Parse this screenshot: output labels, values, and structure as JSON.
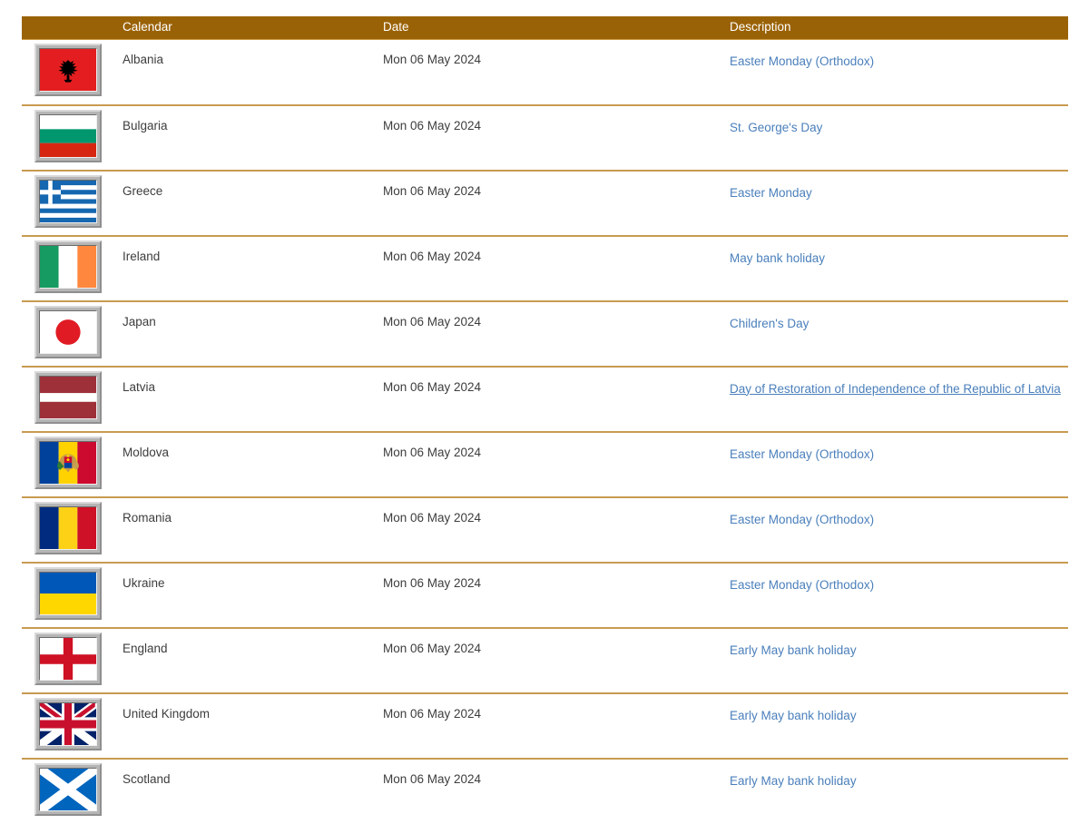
{
  "table": {
    "columns": {
      "flag": "",
      "calendar": "Calendar",
      "date": "Date",
      "description": "Description"
    },
    "header_bg": "#9a6206",
    "row_separator_color": "#c89b50",
    "link_color": "#4a7fbb",
    "text_color": "#3d3d3d",
    "rows": [
      {
        "flag_icon": "flag-albania-icon",
        "calendar": "Albania",
        "date": "Mon 06 May 2024",
        "description": "Easter Monday (Orthodox)",
        "underlined": false
      },
      {
        "flag_icon": "flag-bulgaria-icon",
        "calendar": "Bulgaria",
        "date": "Mon 06 May 2024",
        "description": "St. George's Day",
        "underlined": false
      },
      {
        "flag_icon": "flag-greece-icon",
        "calendar": "Greece",
        "date": "Mon 06 May 2024",
        "description": "Easter Monday",
        "underlined": false
      },
      {
        "flag_icon": "flag-ireland-icon",
        "calendar": "Ireland",
        "date": "Mon 06 May 2024",
        "description": "May bank holiday",
        "underlined": false
      },
      {
        "flag_icon": "flag-japan-icon",
        "calendar": "Japan",
        "date": "Mon 06 May 2024",
        "description": "Children's Day",
        "underlined": false
      },
      {
        "flag_icon": "flag-latvia-icon",
        "calendar": "Latvia",
        "date": "Mon 06 May 2024",
        "description": "Day of Restoration of Independence of the Republic of Latvia",
        "underlined": true
      },
      {
        "flag_icon": "flag-moldova-icon",
        "calendar": "Moldova",
        "date": "Mon 06 May 2024",
        "description": "Easter Monday (Orthodox)",
        "underlined": false
      },
      {
        "flag_icon": "flag-romania-icon",
        "calendar": "Romania",
        "date": "Mon 06 May 2024",
        "description": "Easter Monday (Orthodox)",
        "underlined": false
      },
      {
        "flag_icon": "flag-ukraine-icon",
        "calendar": "Ukraine",
        "date": "Mon 06 May 2024",
        "description": "Easter Monday (Orthodox)",
        "underlined": false
      },
      {
        "flag_icon": "flag-england-icon",
        "calendar": "England",
        "date": "Mon 06 May 2024",
        "description": "Early May bank holiday",
        "underlined": false
      },
      {
        "flag_icon": "flag-united-kingdom-icon",
        "calendar": "United Kingdom",
        "date": "Mon 06 May 2024",
        "description": "Early May bank holiday",
        "underlined": false
      },
      {
        "flag_icon": "flag-scotland-icon",
        "calendar": "Scotland",
        "date": "Mon 06 May 2024",
        "description": "Early May bank holiday",
        "underlined": false
      }
    ]
  }
}
